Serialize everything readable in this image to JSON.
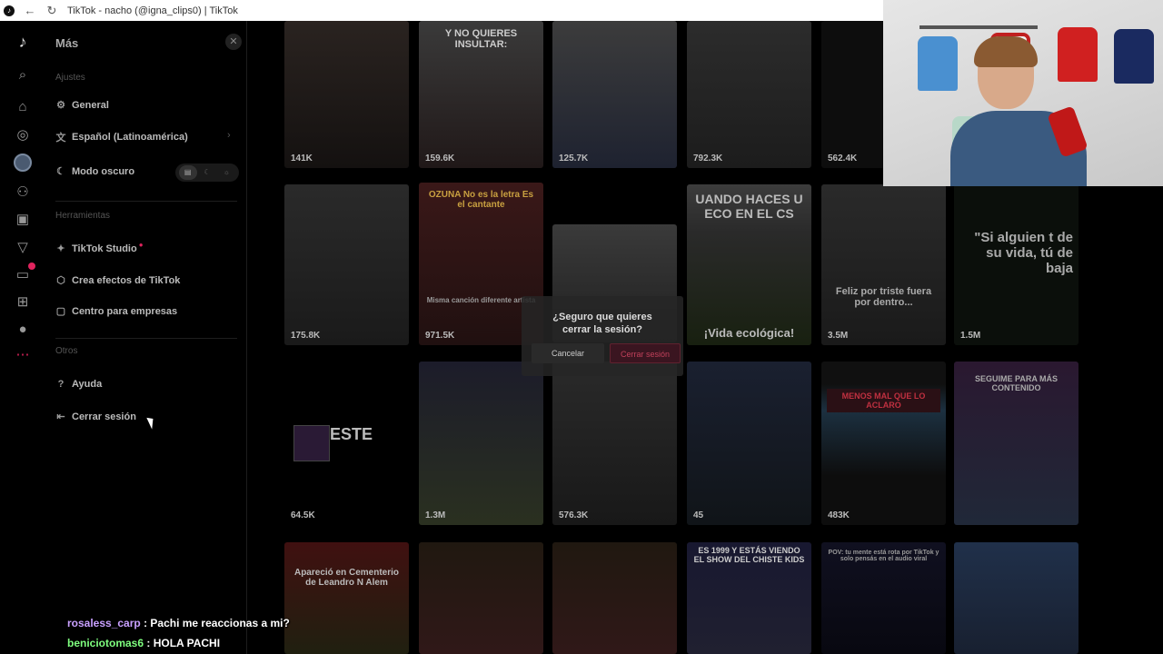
{
  "browser": {
    "tab_title": "TikTok - nacho (@igna_clips0) | TikTok"
  },
  "panel": {
    "title": "Más",
    "section_ajustes": "Ajustes",
    "general": "General",
    "language": "Español (Latinoamérica)",
    "dark_mode": "Modo oscuro",
    "section_herramientas": "Herramientas",
    "studio": "TikTok Studio",
    "effects": "Crea efectos de TikTok",
    "business": "Centro para empresas",
    "section_otros": "Otros",
    "help": "Ayuda",
    "logout": "Cerrar sesión"
  },
  "dialog": {
    "question": "¿Seguro que quieres cerrar la sesión?",
    "cancel": "Cancelar",
    "confirm": "Cerrar sesión"
  },
  "videos": [
    {
      "views": "141K",
      "caption": ""
    },
    {
      "views": "159.6K",
      "caption": "Y NO QUIERES INSULTAR:"
    },
    {
      "views": "125.7K",
      "caption": ""
    },
    {
      "views": "792.3K",
      "caption": ""
    },
    {
      "views": "562.4K",
      "caption": ""
    },
    {
      "views": "175.8K",
      "caption": ""
    },
    {
      "views": "971.5K",
      "caption": "OZUNA No es la letra Es el cantante"
    },
    {
      "views": "",
      "caption": ""
    },
    {
      "views": "",
      "caption": "UANDO HACES U ECO EN EL CS"
    },
    {
      "views": "3.5M",
      "caption": "Feliz por triste fuera por dentro..."
    },
    {
      "views": "1.5M",
      "caption": "\"Si alguien t de su vida, tú de baja"
    },
    {
      "views": "64.5K",
      "caption": "ESTE"
    },
    {
      "views": "1.3M",
      "caption": ""
    },
    {
      "views": "576.3K",
      "caption": ""
    },
    {
      "views": "45",
      "caption": ""
    },
    {
      "views": "483K",
      "caption": "MENOS MAL QUE LO ACLARO"
    },
    {
      "views": "",
      "caption": "SEGUIME PARA MÁS CONTENIDO"
    },
    {
      "views": "",
      "caption": "Apareció en Cementerio de Leandro N Alem"
    },
    {
      "views": "",
      "caption": ""
    },
    {
      "views": "",
      "caption": ""
    },
    {
      "views": "",
      "caption": "ES 1999 Y ESTÁS VIENDO EL SHOW DEL CHISTE KIDS"
    },
    {
      "views": "",
      "caption": "POV: tu mente está rota por TikTok y solo pensás en el audio viral"
    },
    {
      "views": "",
      "caption": ""
    }
  ],
  "video_extra": {
    "eco_bottom": "¡Vida ecológica!",
    "ozuna_sub": "Misma canción diferente artista"
  },
  "chat": [
    {
      "user": "rosaless_carp",
      "message": ": Pachi me reaccionas a mi?"
    },
    {
      "user": "beniciotomas6",
      "message": ": HOLA PACHI"
    }
  ],
  "colors": {
    "accent": "#fe2c55",
    "dialog_confirm": "#c0405a"
  }
}
